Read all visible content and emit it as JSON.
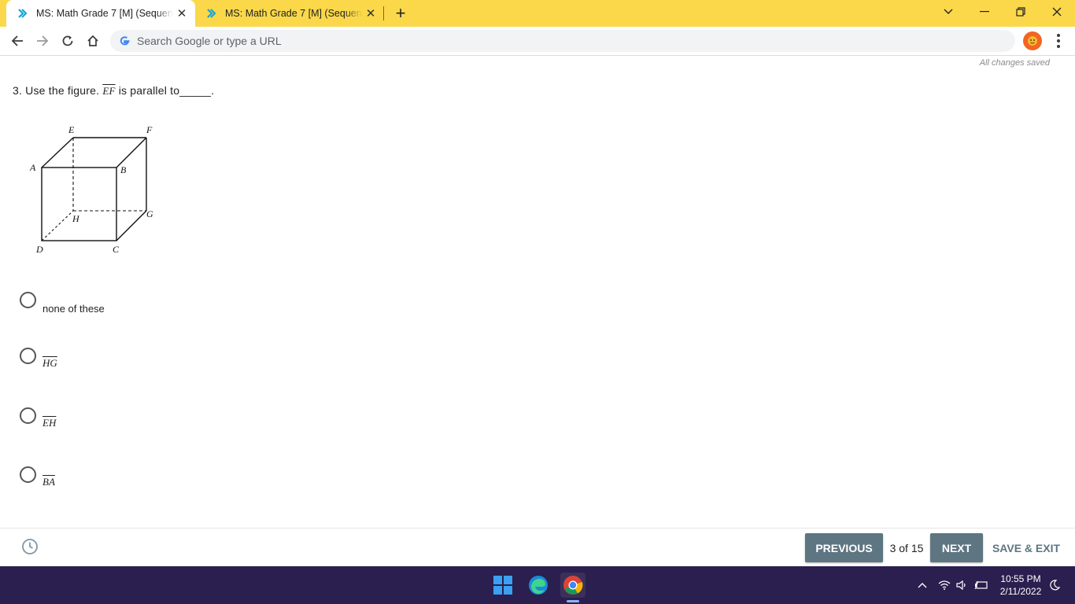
{
  "browser": {
    "tabs": [
      {
        "title": "MS: Math Grade 7 [M] (Sequential)",
        "active": true
      },
      {
        "title": "MS: Math Grade 7 [M] (Sequential)",
        "active": false
      }
    ],
    "omnibox_placeholder": "Search Google or type a URL",
    "accent_color": "#fad84a"
  },
  "page": {
    "save_status": "All changes saved",
    "question": {
      "prefix": "3. Use the figure.",
      "segment": "EF",
      "suffix": "is parallel to_____."
    },
    "figure_labels": {
      "E": "E",
      "F": "F",
      "A": "A",
      "B": "B",
      "H": "H",
      "G": "G",
      "D": "D",
      "C": "C"
    },
    "options": [
      {
        "label": "none of these",
        "is_segment": false
      },
      {
        "label": "HG",
        "is_segment": true
      },
      {
        "label": "EH",
        "is_segment": true
      },
      {
        "label": "BA",
        "is_segment": true
      }
    ]
  },
  "footer": {
    "previous_label": "PREVIOUS",
    "page_count": "3 of 15",
    "next_label": "NEXT",
    "save_exit_label": "SAVE & EXIT",
    "button_color": "#5e7582"
  },
  "taskbar": {
    "time": "10:55 PM",
    "date": "2/11/2022"
  }
}
